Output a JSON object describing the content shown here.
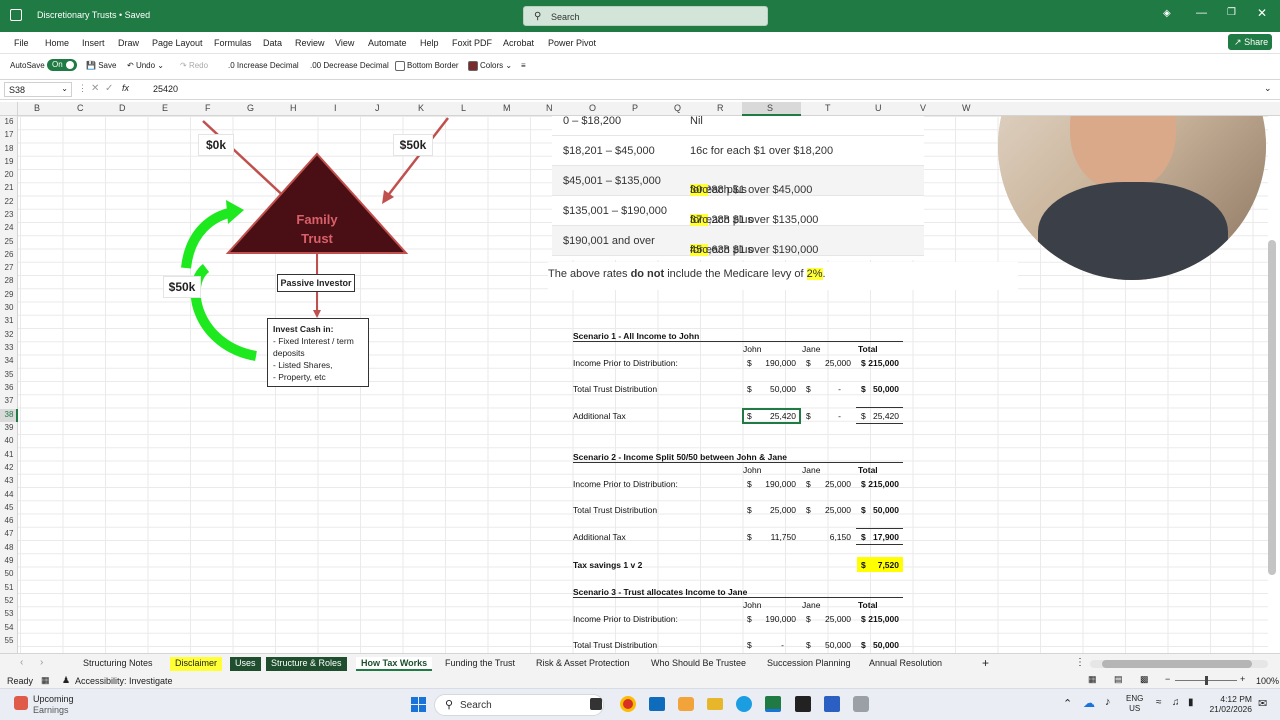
{
  "titlebar": {
    "doc_title": "Discretionary Trusts • Saved",
    "search_placeholder": "Search"
  },
  "menu": [
    "File",
    "Home",
    "Insert",
    "Draw",
    "Page Layout",
    "Formulas",
    "Data",
    "Review",
    "View",
    "Automate",
    "Help",
    "Foxit PDF",
    "Acrobat",
    "Power Pivot"
  ],
  "share_label": "Share",
  "toolbar": {
    "autosave_label": "AutoSave",
    "autosave_state": "On",
    "save": "Save",
    "undo": "Undo",
    "redo": "Redo",
    "increase_decimal": "Increase Decimal",
    "decrease_decimal": "Decrease Decimal",
    "bottom_border": "Bottom Border",
    "colors": "Colors"
  },
  "formula": {
    "name_box": "S38",
    "fx": "fx",
    "content": "25420"
  },
  "columns": [
    "B",
    "C",
    "D",
    "E",
    "F",
    "G",
    "H",
    "I",
    "J",
    "K",
    "L",
    "M",
    "N",
    "O",
    "P",
    "Q",
    "R",
    "S",
    "T",
    "U",
    "V",
    "W"
  ],
  "rows": [
    "16",
    "17",
    "18",
    "19",
    "20",
    "21",
    "22",
    "23",
    "24",
    "25",
    "26",
    "27",
    "28",
    "29",
    "30",
    "31",
    "32",
    "33",
    "34",
    "35",
    "36",
    "37",
    "38",
    "39",
    "40",
    "41",
    "42",
    "43",
    "44",
    "45",
    "46",
    "47",
    "48",
    "49",
    "50",
    "51",
    "52",
    "53",
    "54",
    "55"
  ],
  "diagram": {
    "left_top_amount": "$0k",
    "right_top_amount": "$50k",
    "trust_label_line1": "Family",
    "trust_label_line2": "Trust",
    "loop_amount": "$50k",
    "passive_investor": "Passive Investor",
    "invest_title": "Invest Cash in:",
    "invest_lines": [
      "- Fixed Interest / term",
      "deposits",
      "- Listed Shares,",
      "- Property, etc"
    ]
  },
  "tax_rates": [
    {
      "range": "0 – $18,200",
      "rate_pre": "Nil",
      "rate_hl": "",
      "rate_post": ""
    },
    {
      "range": "$18,201 – $45,000",
      "rate_pre": "16c for each $1 over $18,200",
      "rate_hl": "",
      "rate_post": ""
    },
    {
      "range": "$45,001 – $135,000",
      "rate_pre": "$4,288 plus ",
      "rate_hl": "30c",
      "rate_post": " for each $1 over $45,000"
    },
    {
      "range": "$135,001 – $190,000",
      "rate_pre": "$31,288 plus ",
      "rate_hl": "37c",
      "rate_post": " for each $1 over $135,000"
    },
    {
      "range": "$190,001 and over",
      "rate_pre": "$51,638 plus ",
      "rate_hl": "45c",
      "rate_post": " for each $1 over $190,000"
    }
  ],
  "medicare_note": {
    "pre": "The above rates ",
    "bold": "do not",
    "mid": " include the Medicare levy of ",
    "hl": "2%",
    "post": "."
  },
  "scenario1": {
    "title": "Scenario 1 - All Income to John",
    "headers": [
      "John",
      "Jane",
      "Total"
    ],
    "rows": [
      {
        "label": "Income Prior to Distribution:",
        "john": "190,000",
        "jane": "25,000",
        "total": "215,000"
      },
      {
        "label": "Total Trust Distribution",
        "john": "50,000",
        "jane": "-",
        "total": "50,000"
      },
      {
        "label": "Additional Tax",
        "john": "25,420",
        "jane": "-",
        "total": "25,420"
      }
    ]
  },
  "scenario2": {
    "title": "Scenario 2 - Income Split 50/50 between John & Jane",
    "headers": [
      "John",
      "Jane",
      "Total"
    ],
    "rows": [
      {
        "label": "Income Prior to Distribution:",
        "john": "190,000",
        "jane": "25,000",
        "total": "215,000"
      },
      {
        "label": "Total Trust Distribution",
        "john": "25,000",
        "jane": "25,000",
        "total": "50,000"
      },
      {
        "label": "Additional Tax",
        "john": "11,750",
        "jane": "6,150",
        "total": "17,900"
      }
    ],
    "savings_label": "Tax savings 1 v 2",
    "savings_value": "7,520"
  },
  "scenario3": {
    "title": "Scenario 3 - Trust allocates Income to Jane",
    "headers": [
      "John",
      "Jane",
      "Total"
    ],
    "rows": [
      {
        "label": "Income Prior to Distribution:",
        "john": "190,000",
        "jane": "25,000",
        "total": "215,000"
      },
      {
        "label": "Total Trust Distribution",
        "john": "-",
        "jane": "50,000",
        "total": "50,000"
      }
    ]
  },
  "currency": "$",
  "sheets": [
    "Structuring Notes",
    "Disclaimer",
    "Uses",
    "Structure & Roles",
    "How Tax Works",
    "Funding the Trust",
    "Risk & Asset Protection",
    "Who Should Be Trustee",
    "Succession Planning",
    "Annual Resolution"
  ],
  "status": {
    "ready": "Ready",
    "accessibility": "Accessibility: Investigate",
    "zoom": "100%"
  },
  "taskbar": {
    "widget_line1": "Upcoming",
    "widget_line2": "Earnings",
    "search": "Search",
    "lang1": "ENG",
    "lang2": "US",
    "time": "4:12 PM",
    "date": "21/02/2026"
  },
  "colors": {
    "excel_green": "#1f7a43",
    "trust_fill": "#4a0f14",
    "arrow_red": "#c0504d",
    "loop_green": "#1ee81e",
    "highlight": "#ffff33"
  }
}
